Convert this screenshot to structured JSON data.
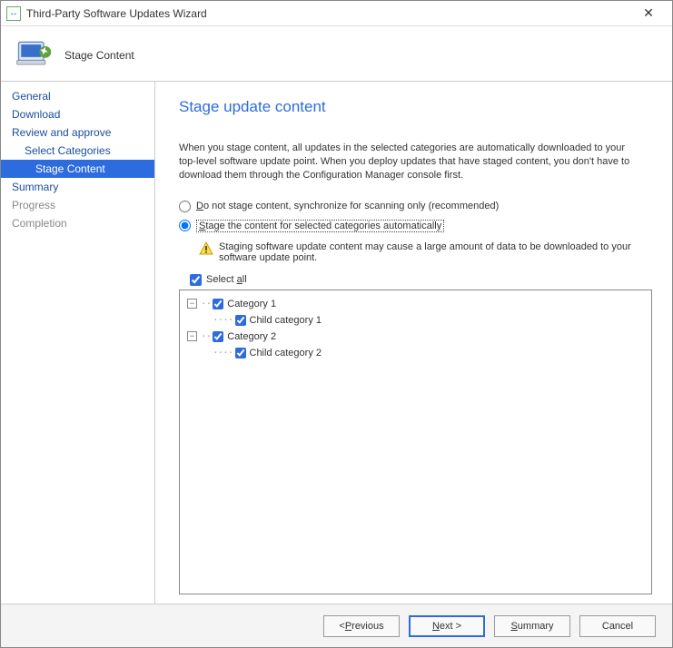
{
  "window": {
    "title": "Third-Party Software Updates Wizard"
  },
  "header": {
    "label": "Stage Content"
  },
  "sidebar": {
    "items": [
      {
        "label": "General"
      },
      {
        "label": "Download"
      },
      {
        "label": "Review and approve"
      },
      {
        "label": "Select Categories"
      },
      {
        "label": "Stage Content"
      },
      {
        "label": "Summary"
      },
      {
        "label": "Progress"
      },
      {
        "label": "Completion"
      }
    ]
  },
  "page": {
    "title": "Stage update content",
    "intro": "When you stage content, all updates in the selected categories are automatically downloaded to your top-level software update point. When you deploy updates that have staged content, you don't have to download them through the Configuration Manager console first.",
    "radio1_pre": "D",
    "radio1_rest": "o not stage content, synchronize for scanning only (recommended)",
    "radio2_pre": "S",
    "radio2_rest": "tage the content for selected categories automatically",
    "warning": "Staging software update content may cause a large amount of data to be downloaded to your software update point.",
    "select_all_pre": "Select ",
    "select_all_u": "a",
    "select_all_rest": "ll",
    "tree": {
      "cat1": "Category 1",
      "child1": "Child category 1",
      "cat2": "Category 2",
      "child2": "Child category 2"
    }
  },
  "footer": {
    "prev_pre": "< ",
    "prev_u": "P",
    "prev_rest": "revious",
    "next_u": "N",
    "next_rest": "ext >",
    "summary_u": "S",
    "summary_rest": "ummary",
    "cancel": "Cancel"
  }
}
